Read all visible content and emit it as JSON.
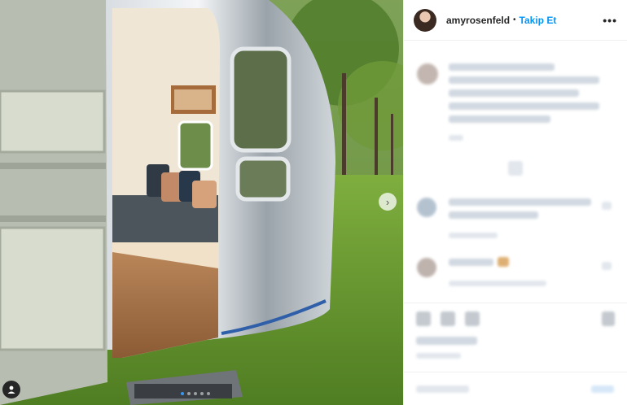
{
  "post": {
    "username": "amyrosenfeld",
    "separator": "•",
    "follow_label": "Takip Et",
    "more_label": "•••"
  },
  "icons": {
    "more": "more-icon",
    "next": "chevron-right-icon",
    "tagged_user": "user-icon",
    "like": "heart-icon",
    "comment": "comment-icon",
    "share": "share-icon",
    "save": "bookmark-icon"
  },
  "carousel": {
    "slide_count": 5,
    "active_index": 0
  },
  "colors": {
    "follow": "#0095f6",
    "active_dot": "#3897f0",
    "text": "#262626"
  }
}
